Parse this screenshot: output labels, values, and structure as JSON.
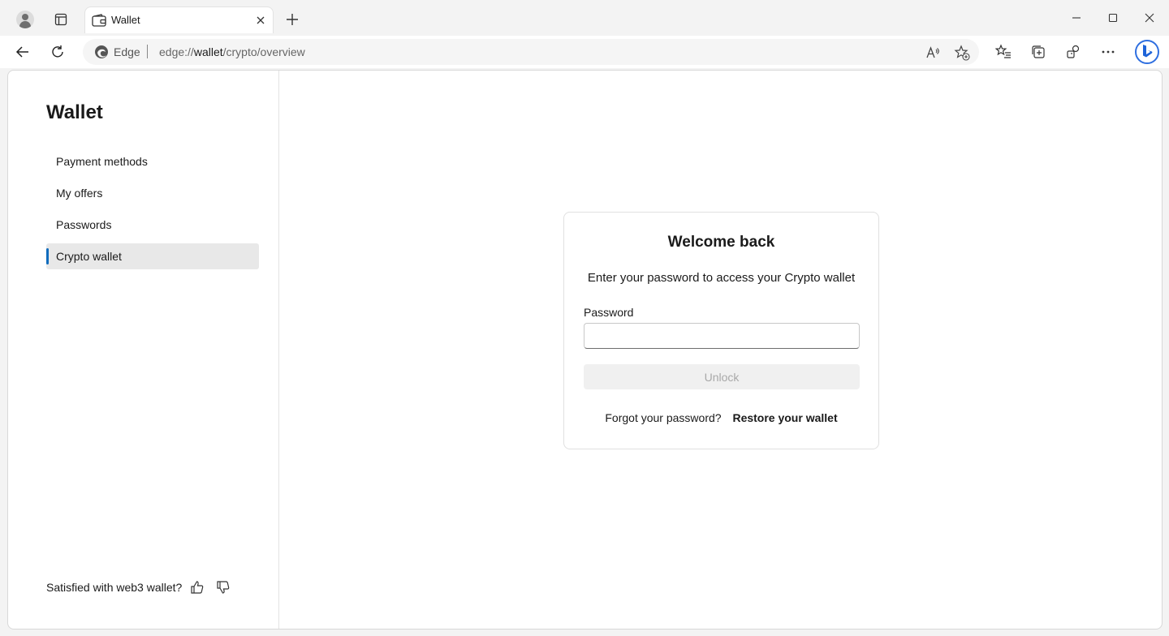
{
  "browser": {
    "tab": {
      "title": "Wallet",
      "icon": "wallet-icon"
    },
    "address": {
      "label": "Edge",
      "url_prefix": "edge://",
      "url_host": "wallet",
      "url_path": "/crypto/overview"
    }
  },
  "sidebar": {
    "title": "Wallet",
    "items": [
      {
        "label": "Payment methods",
        "active": false
      },
      {
        "label": "My offers",
        "active": false
      },
      {
        "label": "Passwords",
        "active": false
      },
      {
        "label": "Crypto wallet",
        "active": true
      }
    ],
    "feedback": {
      "label": "Satisfied with web3 wallet?",
      "like_icon": "thumbs-up-icon",
      "dislike_icon": "thumbs-down-icon"
    }
  },
  "unlock_card": {
    "title": "Welcome back",
    "description": "Enter your password to access your Crypto wallet",
    "password_label": "Password",
    "password_value": "",
    "password_placeholder": "",
    "unlock_label": "Unlock",
    "forgot_text": "Forgot your password?",
    "restore_label": "Restore your wallet"
  },
  "colors": {
    "accent": "#0f6cbd",
    "active_nav_bg": "#e8e8e8",
    "disabled_button_bg": "#f0f0f0",
    "disabled_button_text": "#a8a8a8"
  }
}
